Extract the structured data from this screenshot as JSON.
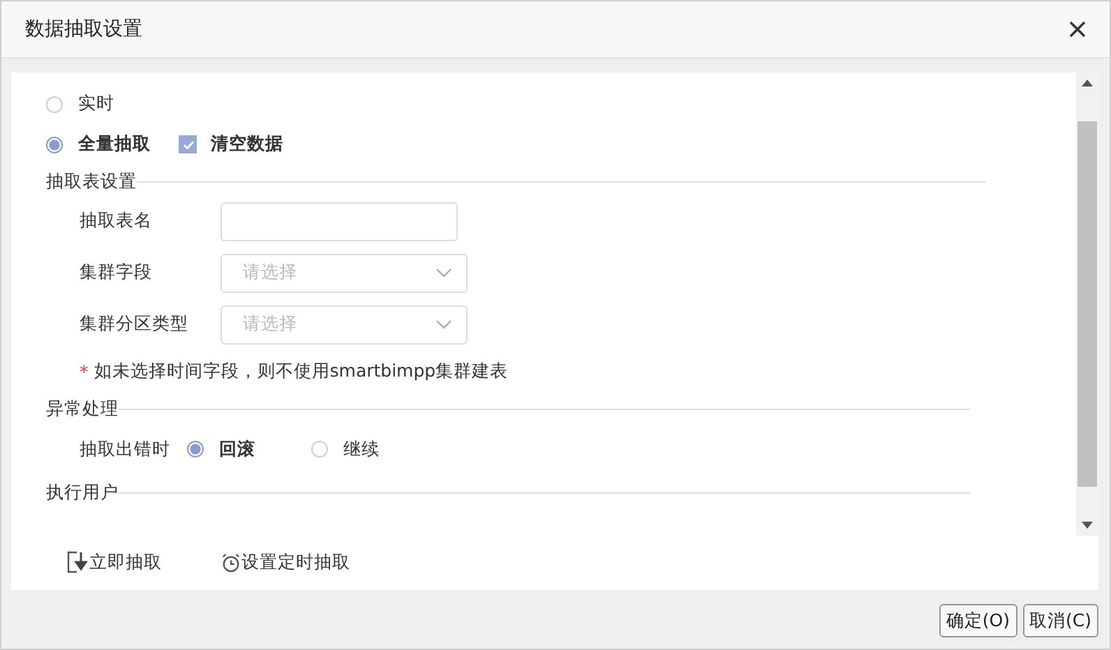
{
  "window": {
    "title": "数据抽取设置"
  },
  "mode_options": [
    {
      "label": "实时",
      "selected": false
    },
    {
      "label": "全量抽取",
      "selected": true
    }
  ],
  "clear_data": {
    "label": "清空数据",
    "checked": true
  },
  "table_settings": {
    "title": "抽取表设置",
    "fields": [
      {
        "kind": "text",
        "label": "抽取表名"
      },
      {
        "kind": "select",
        "label": "集群字段",
        "placeholder": "请选择"
      },
      {
        "kind": "select",
        "label": "集群分区类型",
        "placeholder": "请选择"
      }
    ],
    "note_mark": "*",
    "note": "如未选择时间字段，则不使用smartbimpp集群建表"
  },
  "error_handling": {
    "title": "异常处理",
    "label": "抽取出错时",
    "options": [
      {
        "label": "回滚",
        "selected": true
      },
      {
        "label": "继续",
        "selected": false
      }
    ]
  },
  "exec_user": {
    "title": "执行用户"
  },
  "actions": [
    "立即抽取",
    "设置定时抽取"
  ],
  "buttons": [
    "确定(O)",
    "取消(C)"
  ]
}
